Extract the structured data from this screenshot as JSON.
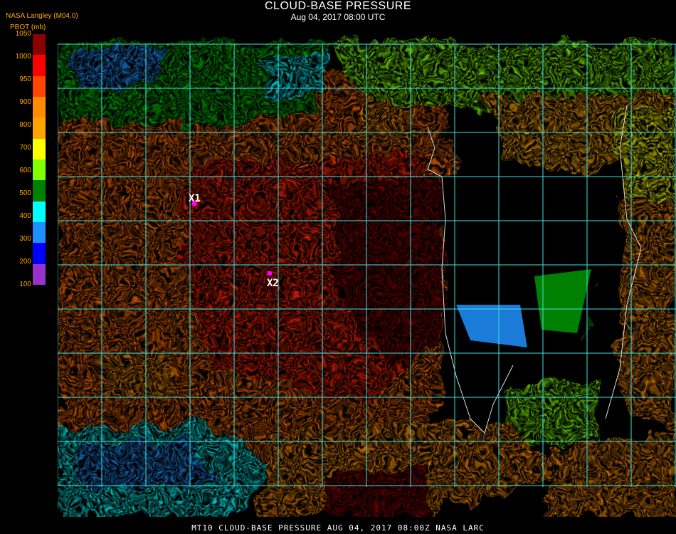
{
  "header": {
    "title": "CLOUD-BASE PRESSURE",
    "date": "Aug 04, 2017 08:00 UTC",
    "source": "NASA Langley (M04.0)",
    "units": "PBOT (mb)"
  },
  "legend": {
    "labels": [
      "1050",
      "1000",
      "950",
      "900",
      "800",
      "700",
      "600",
      "500",
      "400",
      "300",
      "200",
      "100"
    ],
    "colors": [
      "#8b0000",
      "#ff0000",
      "#ff4500",
      "#ff8c00",
      "#ffa500",
      "#ffff00",
      "#7fff00",
      "#008000",
      "#00ffff",
      "#1e90ff",
      "#0000ff",
      "#9932cc"
    ]
  },
  "markers": [
    {
      "label": "X1",
      "color": "#ff00ff"
    },
    {
      "label": "X2",
      "color": "#ff00ff"
    }
  ],
  "footer": {
    "text": "MT10  CLOUD-BASE PRESSURE   AUG 04, 2017 08:00Z   NASA LARC"
  }
}
